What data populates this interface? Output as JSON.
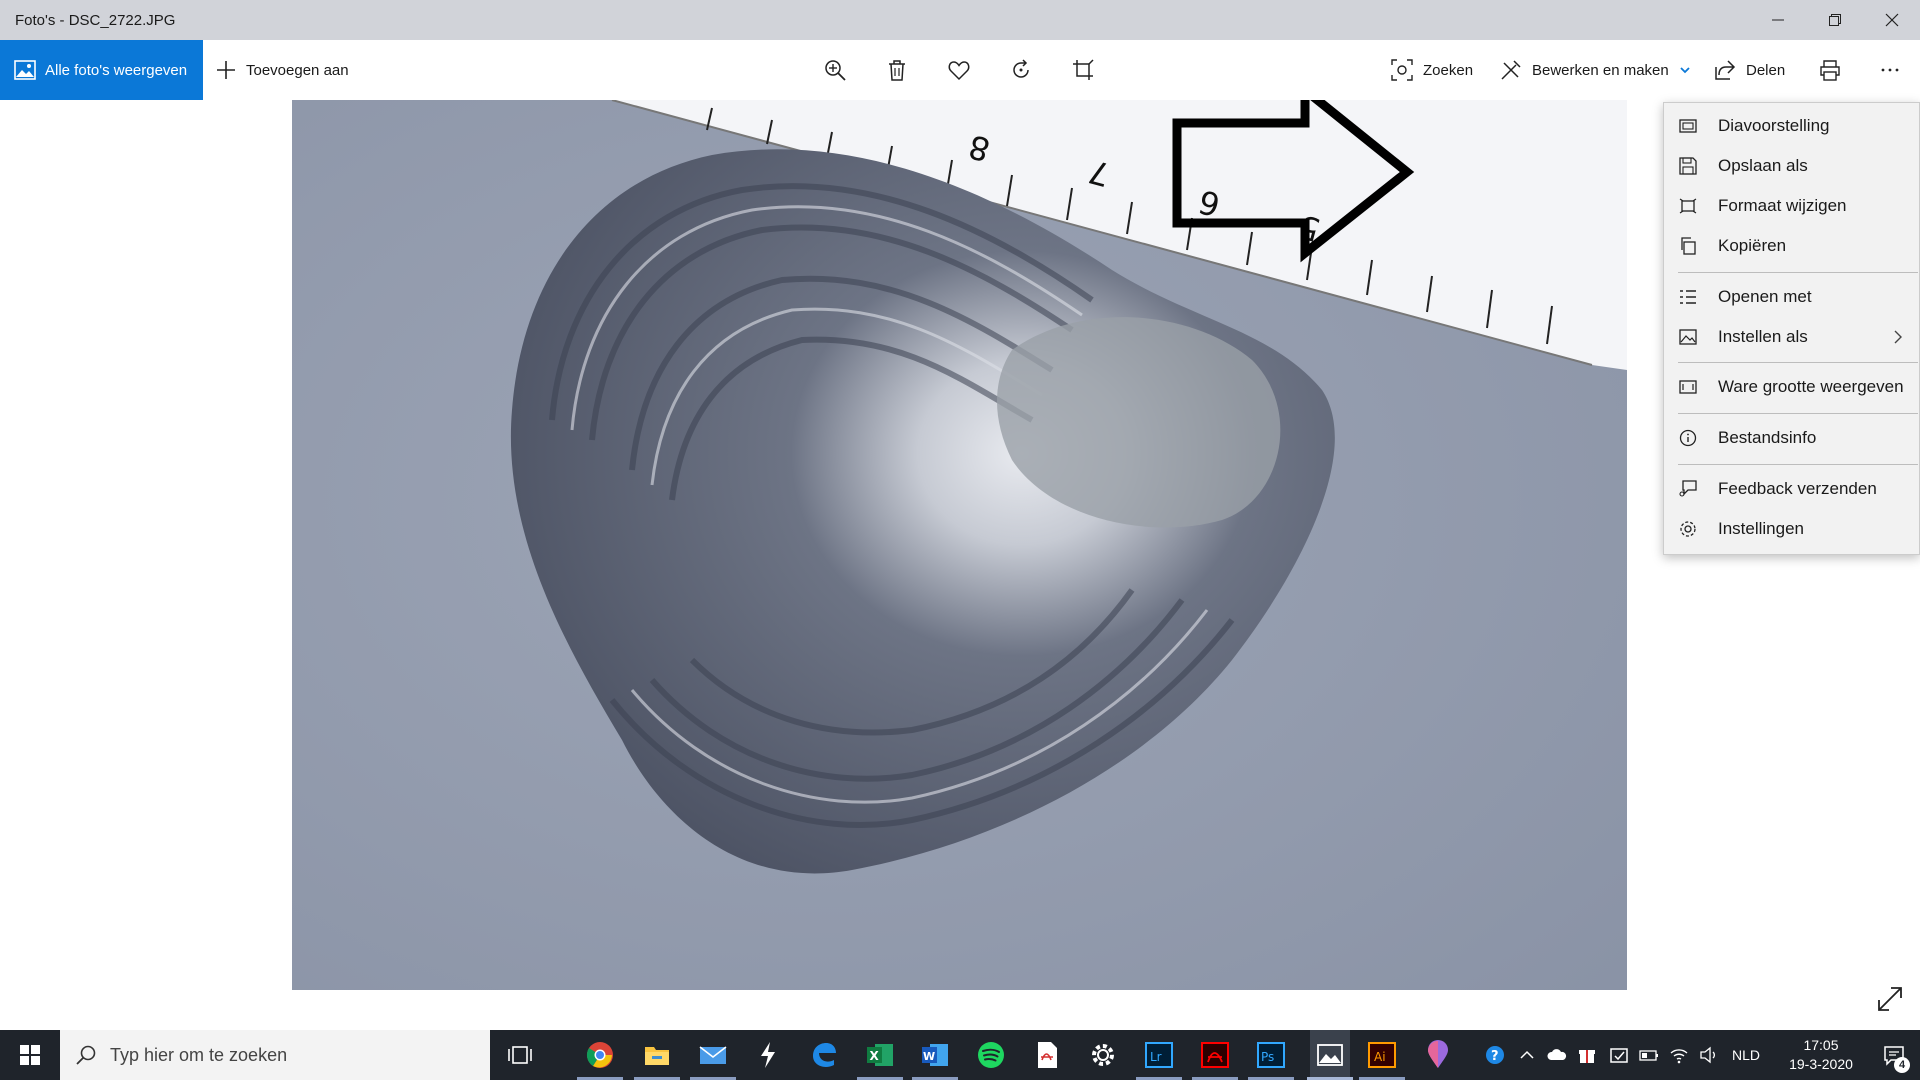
{
  "window": {
    "title": "Foto's - DSC_2722.JPG",
    "controls": [
      "minimize-icon",
      "restore-icon",
      "close-icon"
    ]
  },
  "commandbar": {
    "all_photos_label": "Alle foto's weergeven",
    "add_to_label": "Toevoegen aan",
    "center_icons": [
      "zoom-in-icon",
      "delete-icon",
      "favorite-icon",
      "rotate-icon",
      "crop-icon"
    ],
    "search_label": "Zoeken",
    "edit_label": "Bewerken en maken",
    "share_label": "Delen",
    "print_icon": "print-icon",
    "more_icon": "more-icon"
  },
  "menu": {
    "items": [
      {
        "label": "Diavoorstelling",
        "icon": "slideshow-icon"
      },
      {
        "label": "Opslaan als",
        "icon": "save-icon"
      },
      {
        "label": "Formaat wijzigen",
        "icon": "resize-icon"
      },
      {
        "label": "Kopiëren",
        "icon": "copy-icon"
      },
      {
        "label": "Openen met",
        "icon": "open-with-icon"
      },
      {
        "label": "Instellen als",
        "icon": "set-as-icon",
        "has_submenu": true
      },
      {
        "label": "Ware grootte weergeven",
        "icon": "actual-size-icon"
      },
      {
        "label": "Bestandsinfo",
        "icon": "info-icon"
      },
      {
        "label": "Feedback verzenden",
        "icon": "feedback-icon"
      },
      {
        "label": "Instellingen",
        "icon": "settings-icon"
      }
    ]
  },
  "taskbar": {
    "search_placeholder": "Typ hier om te zoeken",
    "apps": [
      "task-view-icon",
      "chrome-icon",
      "file-explorer-icon",
      "mail-icon",
      "sketch-app-icon",
      "edge-icon",
      "excel-icon",
      "word-icon",
      "spotify-icon",
      "pdf-icon",
      "settings-icon",
      "lightroom-icon",
      "acrobat-icon",
      "photoshop-icon",
      "photos-icon",
      "illustrator-icon",
      "maps-icon"
    ],
    "language": "NLD",
    "time": "17:05",
    "date": "19-3-2020",
    "notification_count": "4"
  },
  "colors": {
    "accent": "#0b78d7",
    "titlebar": "#d1d3d9",
    "menu_bg": "#f2f2f2",
    "taskbar": "#1f242b"
  }
}
